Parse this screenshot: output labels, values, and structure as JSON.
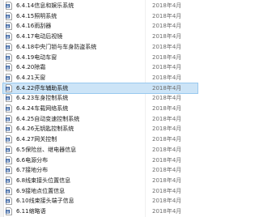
{
  "file_list": {
    "items": [
      {
        "name": "6.4.14信息和娱乐系统",
        "date": "2018年4月"
      },
      {
        "name": "6.4.15照明系统",
        "date": "2018年4月"
      },
      {
        "name": "6.4.16雨刮器",
        "date": "2018年4月"
      },
      {
        "name": "6.4.17电动后视镜",
        "date": "2018年4月"
      },
      {
        "name": "6.4.18中央门锁与车身防盗系统",
        "date": "2018年4月"
      },
      {
        "name": "6.4.19电动车窗",
        "date": "2018年4月"
      },
      {
        "name": "6.4.20除霜",
        "date": "2018年4月"
      },
      {
        "name": "6.4.21天窗",
        "date": "2018年4月"
      },
      {
        "name": "6.4.22停车辅助系统",
        "date": "2018年4月"
      },
      {
        "name": "6.4.23车身控制系统",
        "date": "2018年4月"
      },
      {
        "name": "6.4.24车载网络系统",
        "date": "2018年4月"
      },
      {
        "name": "6.4.25自动变速控制系统",
        "date": "2018年4月"
      },
      {
        "name": "6.4.26无钥匙控制系统",
        "date": "2018年4月"
      },
      {
        "name": "6.4.27网关控制",
        "date": "2018年4月"
      },
      {
        "name": "6.5保险丝、继电器信息",
        "date": "2018年4月"
      },
      {
        "name": "6.6电源分布",
        "date": "2018年4月"
      },
      {
        "name": "6.7接地分布",
        "date": "2018年4月"
      },
      {
        "name": "6.8线束接头位置信息",
        "date": "2018年4月"
      },
      {
        "name": "6.9接地点位置信息",
        "date": "2018年4月"
      },
      {
        "name": "6.10线束接头端子信息",
        "date": "2018年4月"
      },
      {
        "name": "6.11缩略语",
        "date": "2018年4月"
      }
    ],
    "selected_index": 8,
    "icon": "word-document-icon"
  },
  "colors": {
    "selection_background": "#cce4f7",
    "selection_border": "#99c9ef",
    "doc_icon_blue": "#2b579a",
    "date_text": "#6d6d6d"
  }
}
